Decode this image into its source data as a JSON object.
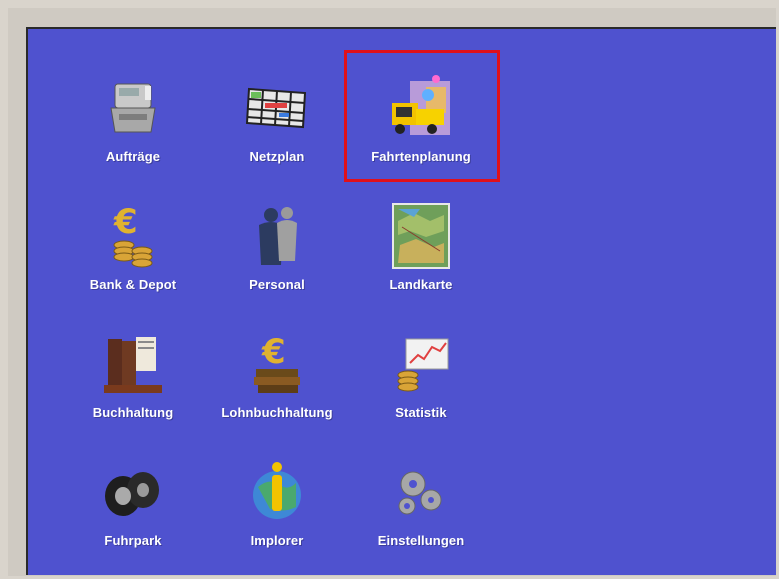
{
  "menu": {
    "items": [
      {
        "id": "auftraege",
        "label": "Aufträge",
        "icon": "cash-register-icon"
      },
      {
        "id": "netzplan",
        "label": "Netzplan",
        "icon": "network-plan-grid-icon"
      },
      {
        "id": "fahrtenplanung",
        "label": "Fahrtenplanung",
        "icon": "truck-map-icon",
        "selected": true
      },
      {
        "id": "bank",
        "label": "Bank & Depot",
        "icon": "euro-coins-icon"
      },
      {
        "id": "personal",
        "label": "Personal",
        "icon": "people-icon"
      },
      {
        "id": "landkarte",
        "label": "Landkarte",
        "icon": "map-icon"
      },
      {
        "id": "buchhaltung",
        "label": "Buchhaltung",
        "icon": "books-icon"
      },
      {
        "id": "lohnbuchhaltung",
        "label": "Lohnbuchhaltung",
        "icon": "euro-books-icon"
      },
      {
        "id": "statistik",
        "label": "Statistik",
        "icon": "chart-coins-icon"
      },
      {
        "id": "fuhrpark",
        "label": "Fuhrpark",
        "icon": "tires-icon"
      },
      {
        "id": "implorer",
        "label": "Implorer",
        "icon": "info-globe-icon"
      },
      {
        "id": "einstellungen",
        "label": "Einstellungen",
        "icon": "gears-icon"
      }
    ]
  },
  "colors": {
    "background": "#4f52cf",
    "selection": "#e0101a"
  }
}
